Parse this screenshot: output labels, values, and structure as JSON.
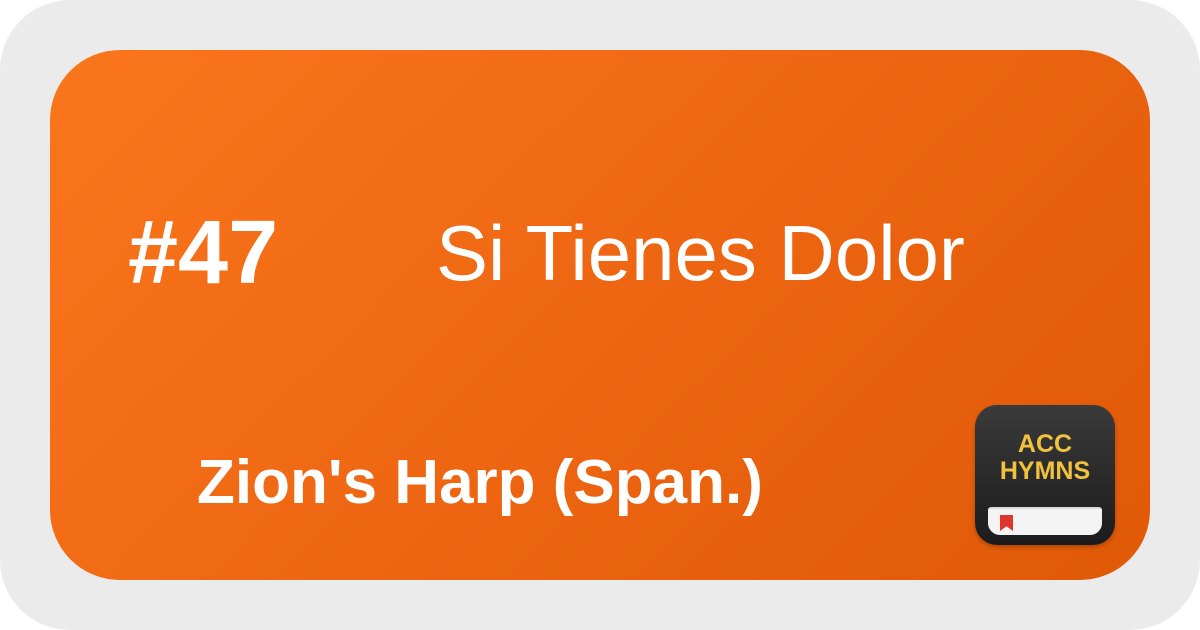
{
  "hymn": {
    "number": "#47",
    "title": "Si Tienes Dolor",
    "collection": "Zion's Harp (Span.)"
  },
  "app_icon": {
    "line1": "ACC",
    "line2": "HYMNS",
    "icon_name": "acc-hymns-app-icon"
  },
  "colors": {
    "background": "#ebebeb",
    "card_gradient_start": "#fa761c",
    "card_gradient_end": "#e05907",
    "text": "#ffffff",
    "icon_background": "#2a2a2a",
    "icon_text": "#f2c23e",
    "bookmark": "#e0342c"
  }
}
